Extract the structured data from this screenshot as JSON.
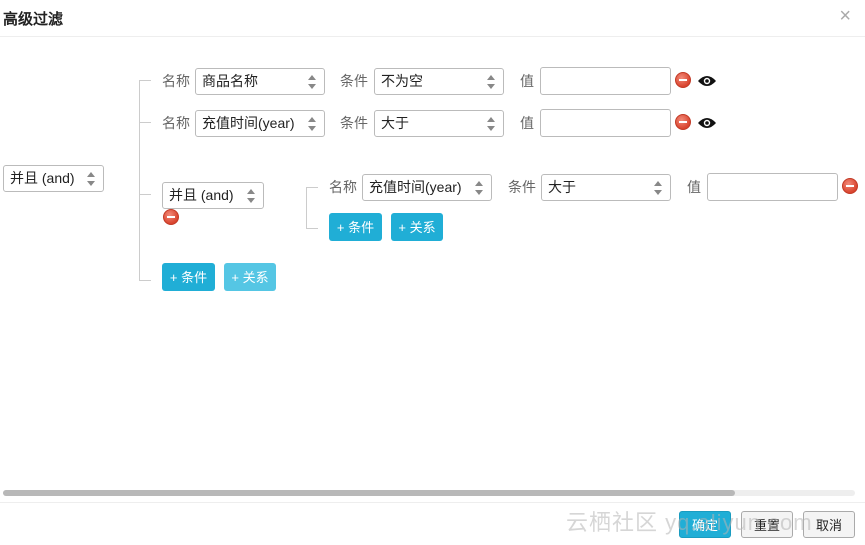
{
  "dialog": {
    "title": "高级过滤",
    "close_glyph": "×"
  },
  "root": {
    "relation": "并且 (and)",
    "rows": [
      {
        "name_label": "名称",
        "name": "商品名称",
        "cond_label": "条件",
        "condition": "不为空",
        "value_label": "值",
        "value": ""
      },
      {
        "name_label": "名称",
        "name": "充值时间(year)",
        "cond_label": "条件",
        "condition": "大于",
        "value_label": "值",
        "value": ""
      }
    ],
    "add_condition": "+ 条件",
    "add_relation": "+ 关系"
  },
  "nested": {
    "relation": "并且 (and)",
    "row": {
      "name_label": "名称",
      "name": "充值时间(year)",
      "cond_label": "条件",
      "condition": "大于",
      "value_label": "值",
      "value": ""
    },
    "add_condition": "+ 条件",
    "add_relation": "+ 关系"
  },
  "footer": {
    "confirm": "确定",
    "reset": "重置",
    "cancel": "取消"
  },
  "watermark": "云栖社区 yq.aliyun.com",
  "colors": {
    "primary": "#20aed6",
    "primary_light": "#55c6e4",
    "danger": "#d9442e"
  },
  "icons": {
    "close": "close-icon",
    "remove": "remove-icon",
    "eye": "eye-icon",
    "select_arrows": "sort-arrows-icon"
  }
}
